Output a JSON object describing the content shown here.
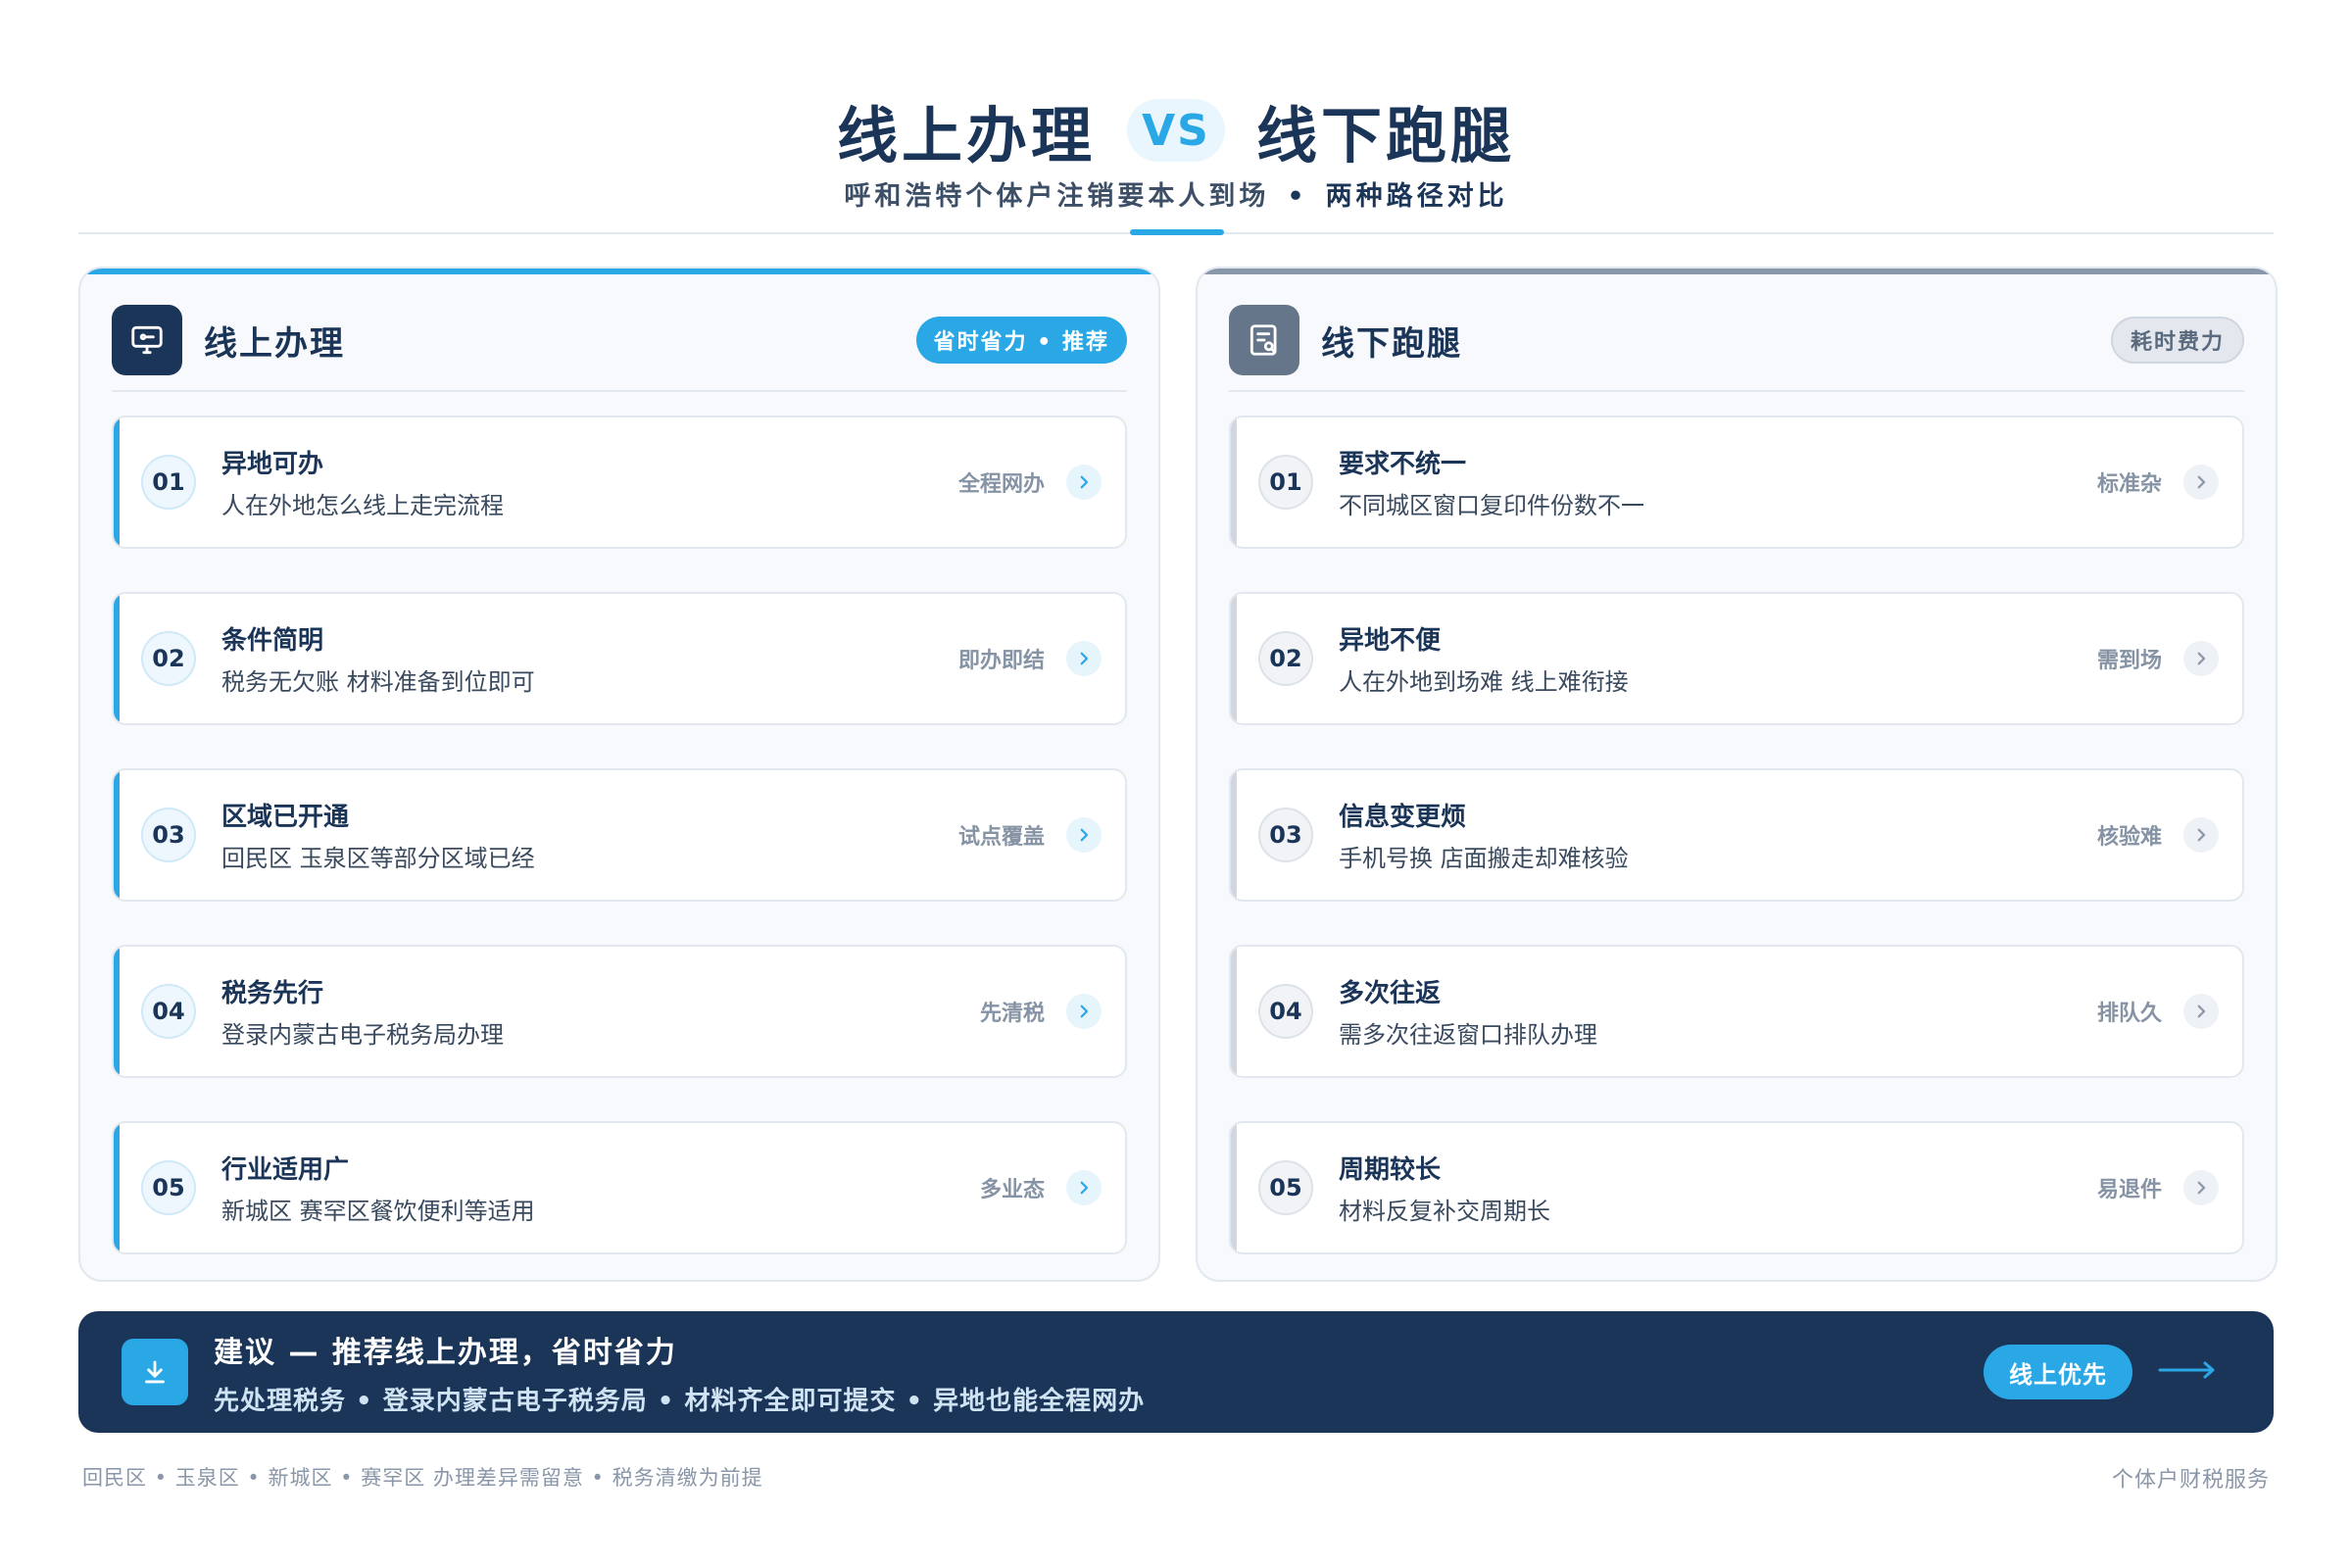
{
  "header": {
    "title_left": "线上办理",
    "vs": "VS",
    "title_right": "线下跑腿",
    "subtitle_main": "呼和浩特个体户注销要本人到场",
    "subtitle_dot": "•",
    "subtitle_strong": "两种路径对比"
  },
  "online": {
    "icon": "monitor-chat-icon",
    "title": "线上办理",
    "tag": "省时省力 • 推荐",
    "accent_color": "#2aa8e6",
    "items": [
      {
        "num": "01",
        "title": "异地可办",
        "desc": "人在外地怎么线上走完流程",
        "tag": "全程网办"
      },
      {
        "num": "02",
        "title": "条件简明",
        "desc": "税务无欠账 材料准备到位即可",
        "tag": "即办即结"
      },
      {
        "num": "03",
        "title": "区域已开通",
        "desc": "回民区 玉泉区等部分区域已经",
        "tag": "试点覆盖"
      },
      {
        "num": "04",
        "title": "税务先行",
        "desc": "登录内蒙古电子税务局办理",
        "tag": "先清税"
      },
      {
        "num": "05",
        "title": "行业适用广",
        "desc": "新城区 赛罕区餐饮便利等适用",
        "tag": "多业态"
      }
    ]
  },
  "offline": {
    "icon": "document-search-icon",
    "title": "线下跑腿",
    "tag": "耗时费力",
    "accent_color": "#8a97a8",
    "items": [
      {
        "num": "01",
        "title": "要求不统一",
        "desc": "不同城区窗口复印件份数不一",
        "tag": "标准杂"
      },
      {
        "num": "02",
        "title": "异地不便",
        "desc": "人在外地到场难 线上难衔接",
        "tag": "需到场"
      },
      {
        "num": "03",
        "title": "信息变更烦",
        "desc": "手机号换 店面搬走却难核验",
        "tag": "核验难"
      },
      {
        "num": "04",
        "title": "多次往返",
        "desc": "需多次往返窗口排队办理",
        "tag": "排队久"
      },
      {
        "num": "05",
        "title": "周期较长",
        "desc": "材料反复补交周期长",
        "tag": "易退件"
      }
    ]
  },
  "banner": {
    "icon": "download-icon",
    "title": "建议 — 推荐线上办理，省时省力",
    "subtitle": "先处理税务 • 登录内蒙古电子税务局 • 材料齐全即可提交 • 异地也能全程网办",
    "button": "线上优先",
    "arrow_icon": "arrow-right-icon"
  },
  "footer": {
    "left": "回民区 • 玉泉区 • 新城区 • 赛罕区 办理差异需留意 • 税务清缴为前提",
    "right": "个体户财税服务"
  },
  "colors": {
    "navy": "#1b3558",
    "accent": "#2aa8e6",
    "muted": "#8a97a8"
  }
}
